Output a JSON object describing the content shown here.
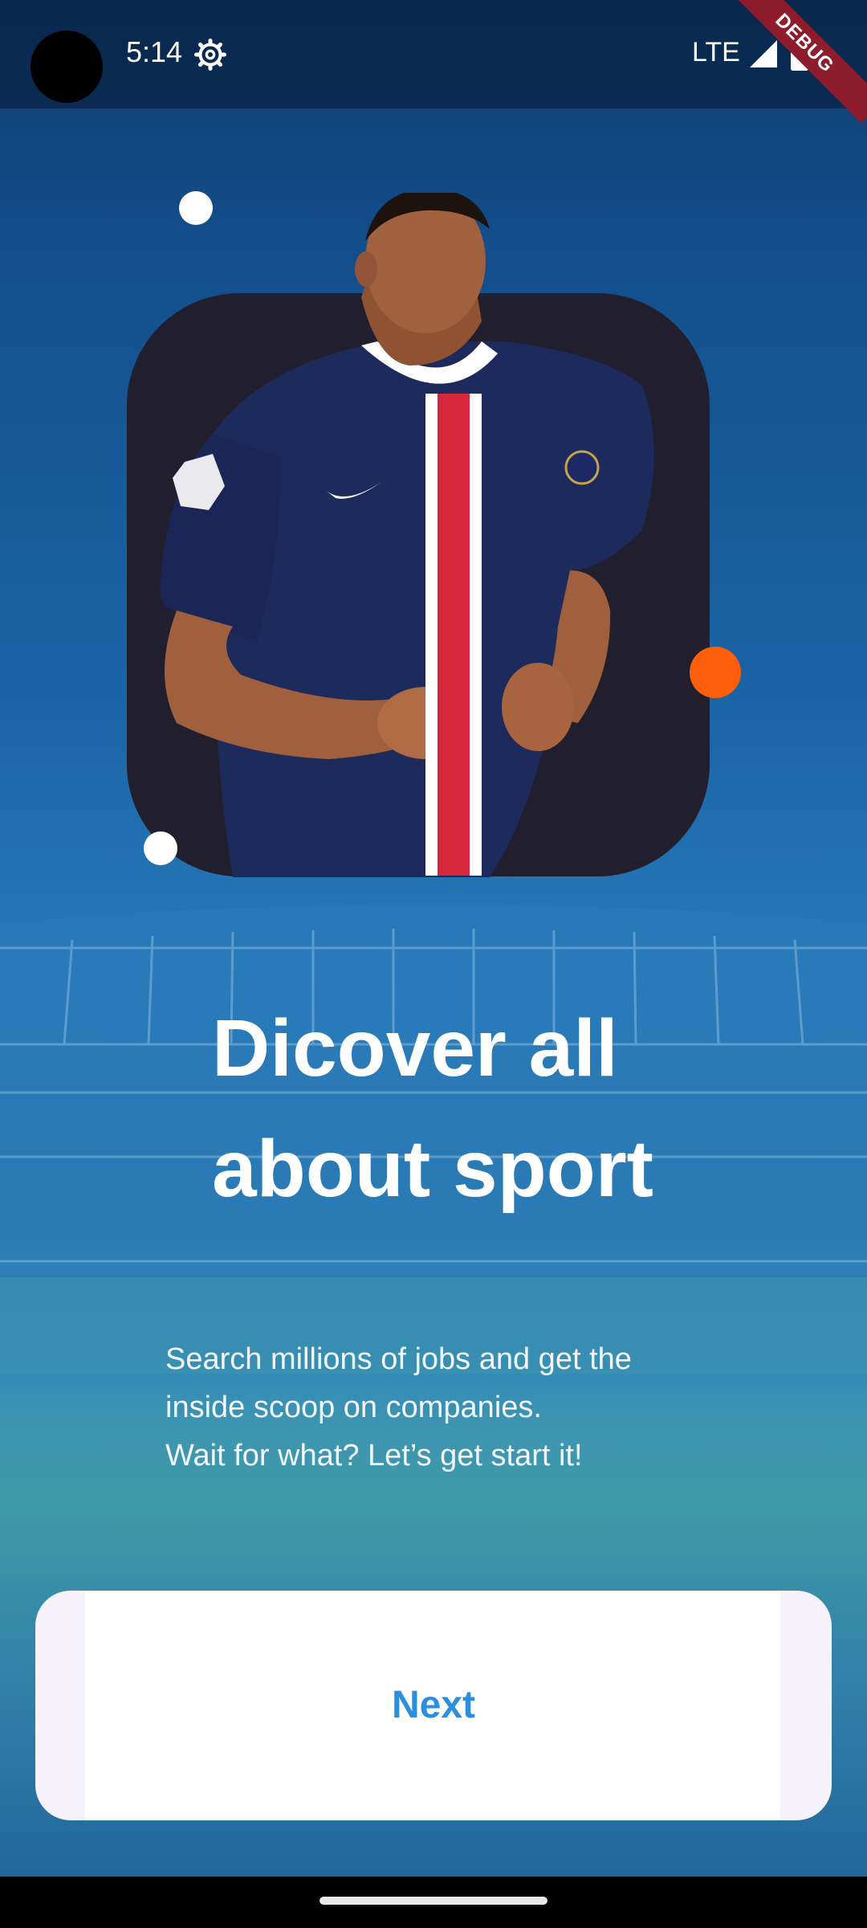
{
  "status_bar": {
    "time": "5:14",
    "network": "LTE",
    "icons": [
      "settings-gear-icon",
      "signal-icon",
      "battery-icon"
    ]
  },
  "debug_banner": "DEBUG",
  "hero": {
    "image": "football-player-photo"
  },
  "onboarding": {
    "title_line1": "Dicover all",
    "title_line2": "about sport",
    "description_lines": [
      "Search millions of jobs and get the",
      "inside scoop on companies.",
      "Wait for what? Let’s get start it!"
    ]
  },
  "actions": {
    "next_label": "Next"
  },
  "colors": {
    "accent": "#2b8fe0",
    "card": "#211e2d",
    "orange_dot": "#ff5e0a",
    "debug_banner": "#8e1c2c"
  }
}
